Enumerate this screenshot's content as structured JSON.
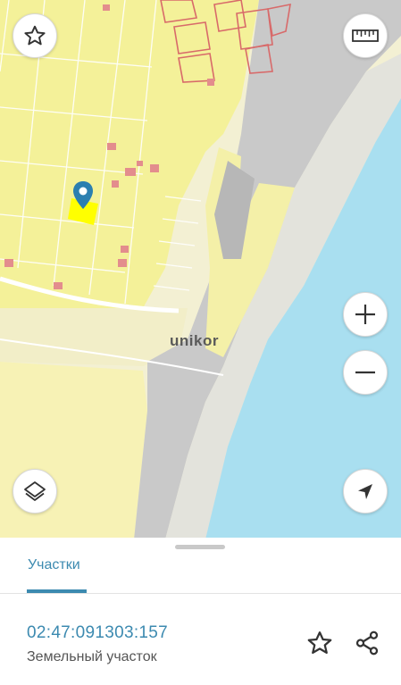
{
  "map": {
    "logo_text": "unikor",
    "controls": {
      "favorite": "star-icon",
      "ruler": "ruler-icon",
      "zoom_in": "plus-icon",
      "zoom_out": "minus-icon",
      "layers": "layers-icon",
      "locate": "navigation-arrow-icon"
    },
    "colors": {
      "parcel_yellow": "#f4f199",
      "selected_parcel": "#ffff00",
      "water": "#aadff0",
      "urban_gray": "#c8c8c8",
      "pin": "#2b7fb0"
    }
  },
  "sheet": {
    "tab_label": "Участки",
    "parcel": {
      "cadastral_number": "02:47:091303:157",
      "type": "Земельный участок"
    },
    "actions": {
      "favorite": "star-outline-icon",
      "share": "share-icon"
    },
    "accent_color": "#3c8ab0"
  }
}
